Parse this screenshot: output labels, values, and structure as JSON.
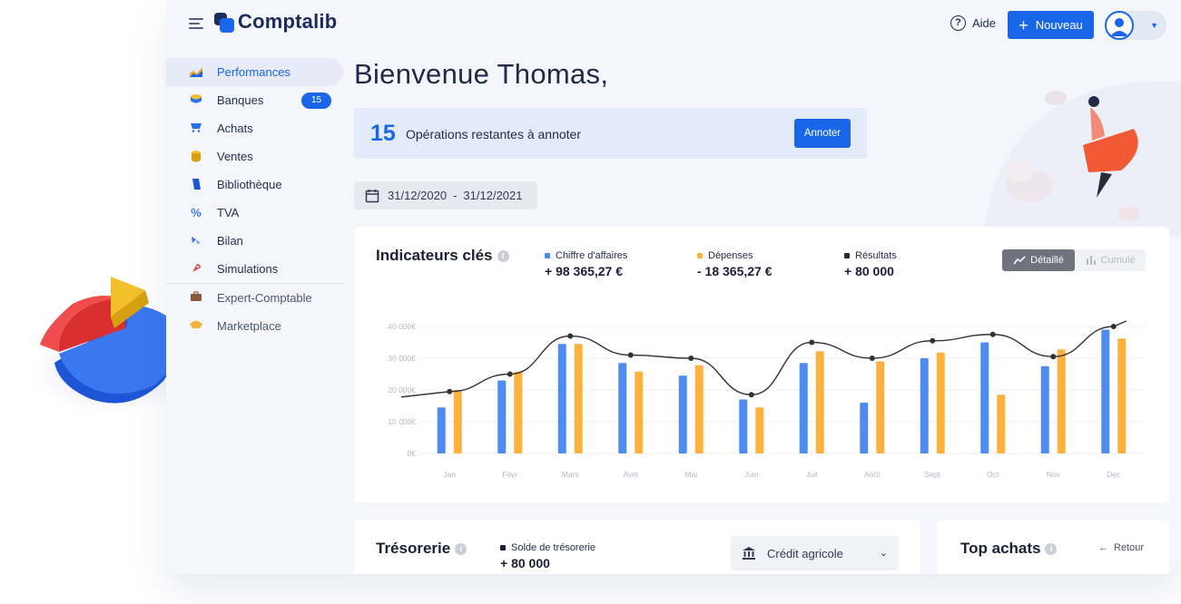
{
  "app": {
    "brand": "Comptalib"
  },
  "header": {
    "help_label": "Aide",
    "new_button_label": "Nouveau"
  },
  "sidebar": {
    "items": [
      {
        "label": "Performances",
        "icon": "chart-icon",
        "active": true
      },
      {
        "label": "Banques",
        "icon": "bank-icon",
        "badge": "15"
      },
      {
        "label": "Achats",
        "icon": "cart-icon"
      },
      {
        "label": "Ventes",
        "icon": "coins-icon"
      },
      {
        "label": "Bibliothèque",
        "icon": "book-icon"
      },
      {
        "label": "TVA",
        "icon": "percent-icon"
      },
      {
        "label": "Bilan",
        "icon": "scale-icon"
      },
      {
        "label": "Simulations",
        "icon": "rocket-icon"
      },
      {
        "label": "Expert-Comptable",
        "icon": "briefcase-icon"
      },
      {
        "label": "Marketplace",
        "icon": "handshake-icon"
      }
    ]
  },
  "main": {
    "welcome": "Bienvenue Thomas,",
    "ops_banner": {
      "count": "15",
      "label": "Opérations restantes à annoter",
      "button": "Annoter"
    },
    "date_range": {
      "start": "31/12/2020",
      "separator": "-",
      "end": "31/12/2021"
    }
  },
  "indicators": {
    "title": "Indicateurs clés",
    "kpis": [
      {
        "label": "Chiffre d'affaires",
        "value": "+ 98 365,27 €",
        "color": "#4f8cf0"
      },
      {
        "label": "Dépenses",
        "value": "- 18 365,27 €",
        "color": "#ffb13d"
      },
      {
        "label": "Résultats",
        "value": "+ 80 000",
        "color": "#2b2b2b"
      }
    ],
    "toggle": {
      "detail": "Détaillé",
      "cumul": "Cumulé"
    }
  },
  "chart_data": {
    "type": "bar",
    "categories": [
      "Jan",
      "Févr",
      "Mars",
      "Avril",
      "Mai",
      "Juin",
      "Juil",
      "Août",
      "Sept",
      "Oct",
      "Nov",
      "Dec"
    ],
    "yticks": [
      "0€",
      "10 000€",
      "20 000€",
      "30 000€",
      "40 000€"
    ],
    "ylim": [
      0,
      40000
    ],
    "series": [
      {
        "name": "Chiffre d'affaires",
        "type": "bar",
        "color": "#4f8cf0",
        "values": [
          14500,
          23000,
          34500,
          28500,
          24500,
          17000,
          28500,
          16000,
          30000,
          35000,
          27500,
          39000
        ]
      },
      {
        "name": "Dépenses",
        "type": "bar",
        "color": "#ffb13d",
        "values": [
          20000,
          25800,
          34500,
          25800,
          27800,
          14500,
          32200,
          29000,
          31800,
          18500,
          32800,
          36200
        ]
      },
      {
        "name": "Résultats",
        "type": "line",
        "color": "#333333",
        "values": [
          19500,
          25000,
          37000,
          31000,
          30000,
          18500,
          35000,
          30000,
          35500,
          37500,
          30500,
          40000
        ]
      }
    ],
    "grid": true
  },
  "tresorerie": {
    "title": "Trésorerie",
    "kpi_label": "Solde de trésorerie",
    "kpi_value": "+ 80 000",
    "bank": "Crédit agricole"
  },
  "top_achats": {
    "title": "Top achats",
    "back": "Retour"
  }
}
